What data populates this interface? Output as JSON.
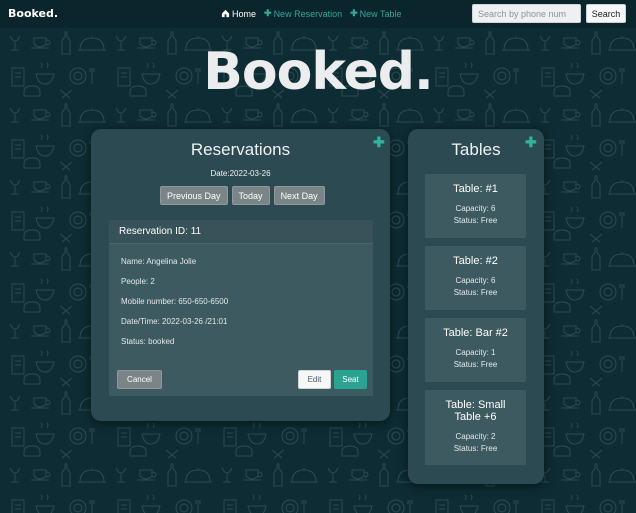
{
  "navbar": {
    "brand": "Booked.",
    "links": [
      {
        "label": "Home",
        "icon": "home-icon"
      },
      {
        "label": "New Reservation",
        "icon": "plus-icon"
      },
      {
        "label": "New Table",
        "icon": "plus-icon"
      }
    ],
    "search_placeholder": "Search by phone num",
    "search_button": "Search"
  },
  "hero": {
    "title": "Booked."
  },
  "reservations": {
    "title": "Reservations",
    "date": "Date:2022-03-26",
    "buttons": [
      "Previous Day",
      "Today",
      "Next Day"
    ],
    "card": {
      "header": "Reservation ID: 11",
      "lines": [
        "Name: Angelina Jolie",
        "People: 2",
        "Mobile number: 650-650-6500",
        "Date/Time: 2022-03-26 /21:01",
        "Status: booked"
      ],
      "cancel": "Cancel",
      "edit": "Edit",
      "seat": "Seat"
    }
  },
  "tables": {
    "title": "Tables",
    "items": [
      {
        "name": "Table: #1",
        "capacity": "Capacity: 6",
        "status": "Status: Free"
      },
      {
        "name": "Table: #2",
        "capacity": "Capacity: 6",
        "status": "Status: Free"
      },
      {
        "name": "Table: Bar #2",
        "capacity": "Capacity: 1",
        "status": "Status: Free"
      },
      {
        "name": "Table: Small Table +6",
        "capacity": "Capacity: 2",
        "status": "Status: Free"
      }
    ]
  },
  "colors": {
    "accent": "#2aa393",
    "background": "#0d2c33",
    "panel": "#2c4a51",
    "card": "#3e5a61"
  }
}
